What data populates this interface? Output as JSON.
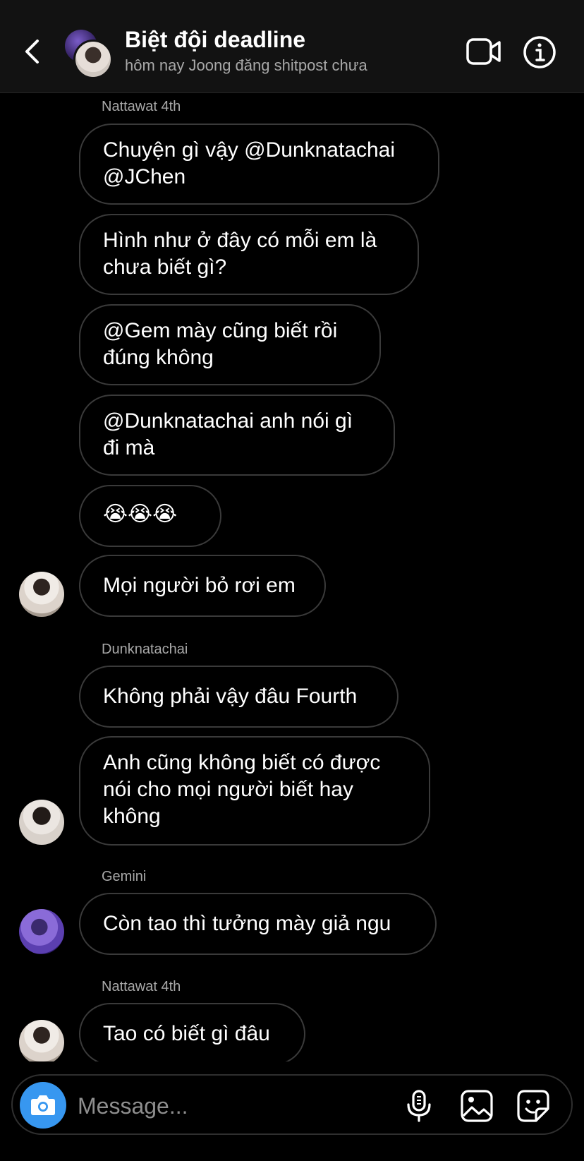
{
  "header": {
    "back_icon": "chevron-left-icon",
    "title": "Biệt đội deadline",
    "subtitle": "hôm nay Joong đăng shitpost chưa",
    "video_icon": "video-camera-icon",
    "info_icon": "info-icon"
  },
  "messages": {
    "senders": [
      "Nattawat 4th",
      "Dunknatachai",
      "Gemini",
      "Nattawat 4th"
    ],
    "bubbles": [
      "Chuyện gì vậy @Dunknatachai\n@JChen",
      "Hình như ở đây có mỗi em là\nchưa biết gì?",
      "@Gem mày cũng biết rồi\nđúng không",
      "@Dunknatachai anh nói gì\nđi mà",
      "😭😭😭",
      "Mọi người bỏ rơi em",
      "Không phải vậy đâu Fourth",
      "Anh cũng không biết có được\nnói cho mọi người biết hay\nkhông",
      "Còn tao thì tưởng mày giả ngu",
      "Tao có biết gì đâu"
    ]
  },
  "composer": {
    "placeholder": "Message...",
    "camera_icon": "camera-icon",
    "mic_icon": "microphone-icon",
    "gallery_icon": "gallery-icon",
    "sticker_icon": "sticker-icon"
  },
  "colors": {
    "background": "#000000",
    "header_bg": "#121212",
    "bubble_border": "#3a3a3a",
    "secondary_text": "#a8a8a8",
    "accent": "#3797f0"
  }
}
